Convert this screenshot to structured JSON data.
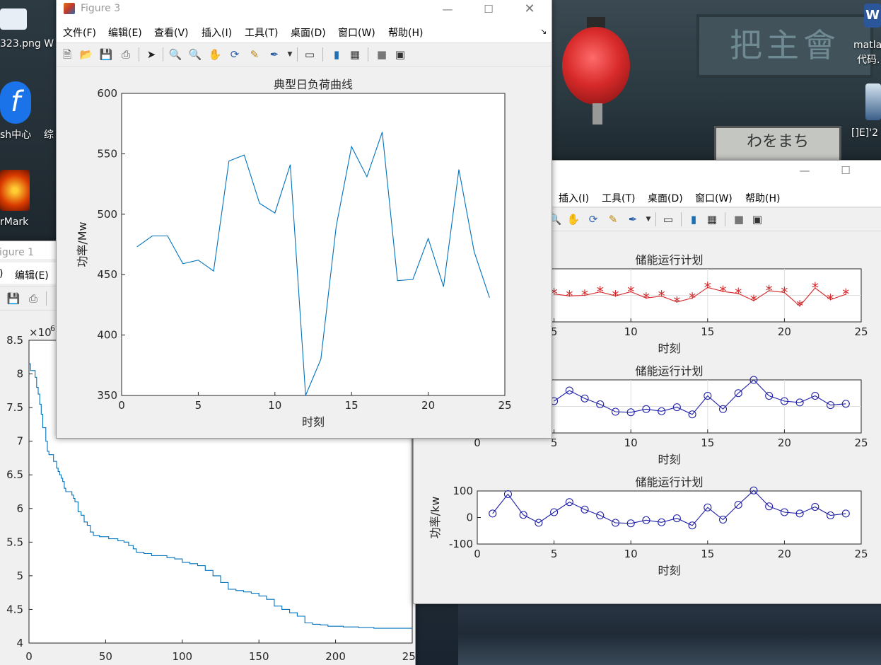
{
  "desktop": {
    "icons": [
      {
        "label": "323.png W"
      },
      {
        "label": "sh中心"
      },
      {
        "label": "综"
      },
      {
        "label": "rMark"
      },
      {
        "label": "matla"
      },
      {
        "label": "代码."
      },
      {
        "label": "[]E]'2"
      }
    ],
    "wallpaper_sign": "把主會",
    "wallpaper_sign2": "わをまち"
  },
  "figure1": {
    "title": "igure 1",
    "menus": [
      {
        "label": ")"
      },
      {
        "label": "编辑(E)"
      }
    ],
    "chart_data": {
      "type": "line",
      "exponent_label": "×10",
      "exponent_power": "6",
      "xlim": [
        0,
        250
      ],
      "ylim": [
        4,
        8.5
      ],
      "x_ticks": [
        "0",
        "50",
        "100",
        "150",
        "200",
        "250"
      ],
      "y_ticks": [
        "4",
        "4.5",
        "5",
        "5.5",
        "6",
        "6.5",
        "7",
        "7.5",
        "8",
        "8.5"
      ],
      "color": "#0072bd",
      "series": [
        {
          "x": [
            0,
            1,
            2,
            3,
            4,
            5,
            6,
            7,
            8,
            9,
            10,
            11,
            12,
            13,
            14,
            15,
            16,
            17,
            18,
            19,
            20,
            21,
            22,
            23,
            24,
            25,
            26,
            27,
            28,
            29,
            30,
            32,
            34,
            36,
            38,
            40,
            42,
            44,
            46,
            48,
            50,
            52,
            54,
            56,
            58,
            60,
            62,
            65,
            68,
            70,
            72,
            75,
            80,
            85,
            90,
            95,
            100,
            105,
            110,
            115,
            120,
            125,
            130,
            135,
            140,
            145,
            150,
            155,
            160,
            165,
            170,
            175,
            180,
            185,
            190,
            195,
            200,
            205,
            210,
            215,
            220,
            225,
            230,
            235,
            240,
            245,
            250
          ],
          "y": [
            8.15,
            8.05,
            8.05,
            8.05,
            7.95,
            7.8,
            7.7,
            7.55,
            7.4,
            7.2,
            7.2,
            7.0,
            6.85,
            6.8,
            6.8,
            6.8,
            6.7,
            6.7,
            6.6,
            6.55,
            6.5,
            6.45,
            6.4,
            6.3,
            6.25,
            6.25,
            6.25,
            6.25,
            6.2,
            6.15,
            6.1,
            5.95,
            5.9,
            5.8,
            5.75,
            5.65,
            5.6,
            5.6,
            5.58,
            5.58,
            5.58,
            5.55,
            5.55,
            5.55,
            5.52,
            5.52,
            5.5,
            5.45,
            5.4,
            5.35,
            5.35,
            5.33,
            5.3,
            5.3,
            5.27,
            5.25,
            5.2,
            5.18,
            5.15,
            5.08,
            5.0,
            4.9,
            4.8,
            4.78,
            4.76,
            4.74,
            4.7,
            4.65,
            4.55,
            4.5,
            4.45,
            4.4,
            4.3,
            4.28,
            4.27,
            4.25,
            4.25,
            4.24,
            4.24,
            4.23,
            4.23,
            4.22,
            4.22,
            4.22,
            4.22,
            4.22,
            4.22
          ]
        }
      ]
    }
  },
  "figure2": {
    "menus": [
      {
        "label": "插入(I)"
      },
      {
        "label": "工具(T)"
      },
      {
        "label": "桌面(D)"
      },
      {
        "label": "窗口(W)"
      },
      {
        "label": "帮助(H)"
      }
    ],
    "chart_data": [
      {
        "type": "line",
        "title": "储能运行计划",
        "xlabel": "时刻",
        "ylabel": "",
        "x_ticks": [
          "5",
          "10",
          "15",
          "20",
          "25"
        ],
        "y_ticks": [],
        "xlim": [
          0,
          25
        ],
        "ylim": [
          -100,
          100
        ],
        "marker": "*",
        "color": "#d62728",
        "grid": true,
        "series": [
          {
            "x": [
              5,
              6,
              7,
              8,
              9,
              10,
              11,
              12,
              13,
              14,
              15,
              16,
              17,
              18,
              19,
              20,
              21,
              22,
              23,
              24
            ],
            "y": [
              5,
              -2,
              0,
              13,
              -2,
              14,
              -10,
              -3,
              -25,
              -10,
              30,
              15,
              7,
              -20,
              18,
              11,
              -40,
              28,
              -16,
              4
            ]
          }
        ]
      },
      {
        "type": "line",
        "title": "储能运行计划",
        "xlabel": "时刻",
        "ylabel": "",
        "x_ticks": [
          "0",
          "5",
          "10",
          "15",
          "20",
          "25"
        ],
        "y_ticks": [],
        "xlim": [
          0,
          25
        ],
        "ylim": [
          -100,
          100
        ],
        "marker": "o",
        "color": "#1f1fa8",
        "grid": true,
        "series": [
          {
            "x": [
              5,
              6,
              7,
              8,
              9,
              10,
              11,
              12,
              13,
              14,
              15,
              16,
              17,
              18,
              19,
              20,
              21,
              22,
              23,
              24
            ],
            "y": [
              20,
              60,
              30,
              8,
              -20,
              -22,
              -10,
              -18,
              -3,
              -30,
              40,
              -10,
              50,
              100,
              40,
              20,
              15,
              40,
              5,
              10
            ]
          }
        ]
      },
      {
        "type": "line",
        "title": "储能运行计划",
        "xlabel": "时刻",
        "ylabel": "功率/kw",
        "x_ticks": [
          "0",
          "5",
          "10",
          "15",
          "20",
          "25"
        ],
        "y_ticks": [
          "100",
          "0",
          "-100"
        ],
        "xlim": [
          0,
          25
        ],
        "ylim": [
          -100,
          100
        ],
        "marker": "o",
        "color": "#1f1fa8",
        "grid": false,
        "series": [
          {
            "x": [
              1,
              2,
              3,
              4,
              5,
              6,
              7,
              8,
              9,
              10,
              11,
              12,
              13,
              14,
              15,
              16,
              17,
              18,
              19,
              20,
              21,
              22,
              23,
              24
            ],
            "y": [
              15,
              88,
              10,
              -20,
              20,
              58,
              30,
              8,
              -20,
              -22,
              -10,
              -18,
              -3,
              -30,
              38,
              -8,
              48,
              102,
              42,
              20,
              15,
              40,
              8,
              15
            ]
          }
        ]
      }
    ]
  },
  "figure3": {
    "title": "Figure 3",
    "menus": [
      {
        "label": "文件(F)"
      },
      {
        "label": "编辑(E)"
      },
      {
        "label": "查看(V)"
      },
      {
        "label": "插入(I)"
      },
      {
        "label": "工具(T)"
      },
      {
        "label": "桌面(D)"
      },
      {
        "label": "窗口(W)"
      },
      {
        "label": "帮助(H)"
      }
    ],
    "chart_data": {
      "type": "line",
      "title": "典型日负荷曲线",
      "xlabel": "时刻",
      "ylabel": "功率/Mw",
      "xlim": [
        0,
        25
      ],
      "ylim": [
        350,
        600
      ],
      "x_ticks": [
        "0",
        "5",
        "10",
        "15",
        "20",
        "25"
      ],
      "y_ticks": [
        "350",
        "400",
        "450",
        "500",
        "550",
        "600"
      ],
      "color": "#0072bd",
      "series": [
        {
          "x": [
            1,
            2,
            3,
            4,
            5,
            6,
            7,
            8,
            9,
            10,
            11,
            12,
            13,
            14,
            15,
            16,
            17,
            18,
            19,
            20,
            21,
            22,
            23,
            24
          ],
          "y": [
            473,
            482,
            482,
            459,
            462,
            453,
            544,
            549,
            509,
            501,
            541,
            350,
            380,
            490,
            556,
            531,
            568,
            445,
            446,
            480,
            440,
            537,
            469,
            431
          ]
        }
      ]
    }
  }
}
